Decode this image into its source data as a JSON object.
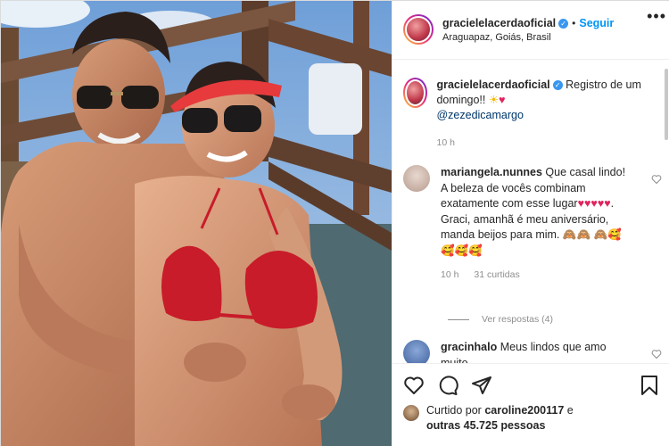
{
  "post": {
    "username": "gracielelacerdaoficial",
    "follow_label": "Seguir",
    "location": "Araguapaz, Goiás, Brasil",
    "more_label": "•••"
  },
  "caption": {
    "username": "gracielelacerdaoficial",
    "text": "Registro de um domingo!!",
    "mention": "@zezedicamargo",
    "time": "10 h"
  },
  "comments": [
    {
      "username": "mariangela.nunnes",
      "text_1": "Que casal lindo! A beleza de vocês combinam exatamente com esse lugar",
      "text_2": ". Graci, amanhã é meu aniversário, manda beijos para mim.",
      "time": "10 h",
      "likes": "31 curtidas",
      "replies": "Ver respostas (4)"
    },
    {
      "username": "gracinhalo",
      "text": "Meus lindos que amo muito"
    }
  ],
  "liked_by": {
    "prefix": "Curtido por",
    "user": "caroline200117",
    "suffix": "e",
    "others": "outras 45.725 pessoas"
  },
  "icons": {
    "like": "heart-icon",
    "comment": "comment-icon",
    "share": "share-icon",
    "save": "bookmark-icon"
  },
  "colors": {
    "follow": "#0095f6",
    "verified": "#3897f0",
    "meta": "#8e8e8e",
    "text": "#262626"
  }
}
